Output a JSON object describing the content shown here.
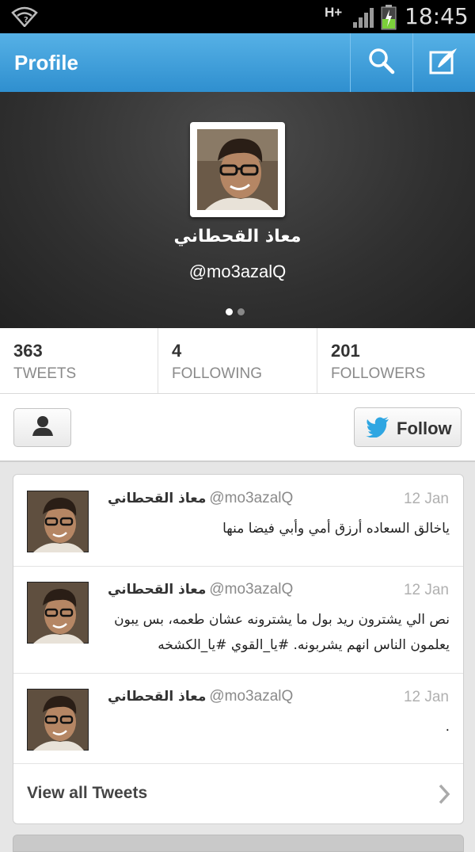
{
  "status_bar": {
    "network": "H+",
    "time": "18:45"
  },
  "action_bar": {
    "title": "Profile",
    "search_icon": "search-icon",
    "compose_icon": "compose-icon",
    "accent": "#3a9bd9"
  },
  "profile": {
    "name": "معاذ القحطاني",
    "handle": "@mo3azalQ",
    "pager": {
      "pages": 2,
      "active": 0
    }
  },
  "stats": [
    {
      "value": "363",
      "label": "TWEETS"
    },
    {
      "value": "4",
      "label": "FOLLOWING"
    },
    {
      "value": "201",
      "label": "FOLLOWERS"
    }
  ],
  "actions": {
    "user_icon": "user-icon",
    "follow_label": "Follow",
    "bird_color": "#2fa6e2"
  },
  "tweets": [
    {
      "author": "معاذ القحطاني",
      "username": "@mo3azalQ",
      "date": "12 Jan",
      "text": "ياخالق السعاده أرزق أمي وأبي فيضا منها"
    },
    {
      "author": "معاذ القحطاني",
      "username": "@mo3azalQ",
      "date": "12 Jan",
      "text": "نص الي يشترون ريد بول ما يشترونه عشان طعمه، بس يبون يعلمون الناس انهم يشربونه. #يا_القوي #يا_الكشخه"
    },
    {
      "author": "معاذ القحطاني",
      "username": "@mo3azalQ",
      "date": "12 Jan",
      "text": "."
    }
  ],
  "view_all": {
    "label": "View all Tweets"
  }
}
